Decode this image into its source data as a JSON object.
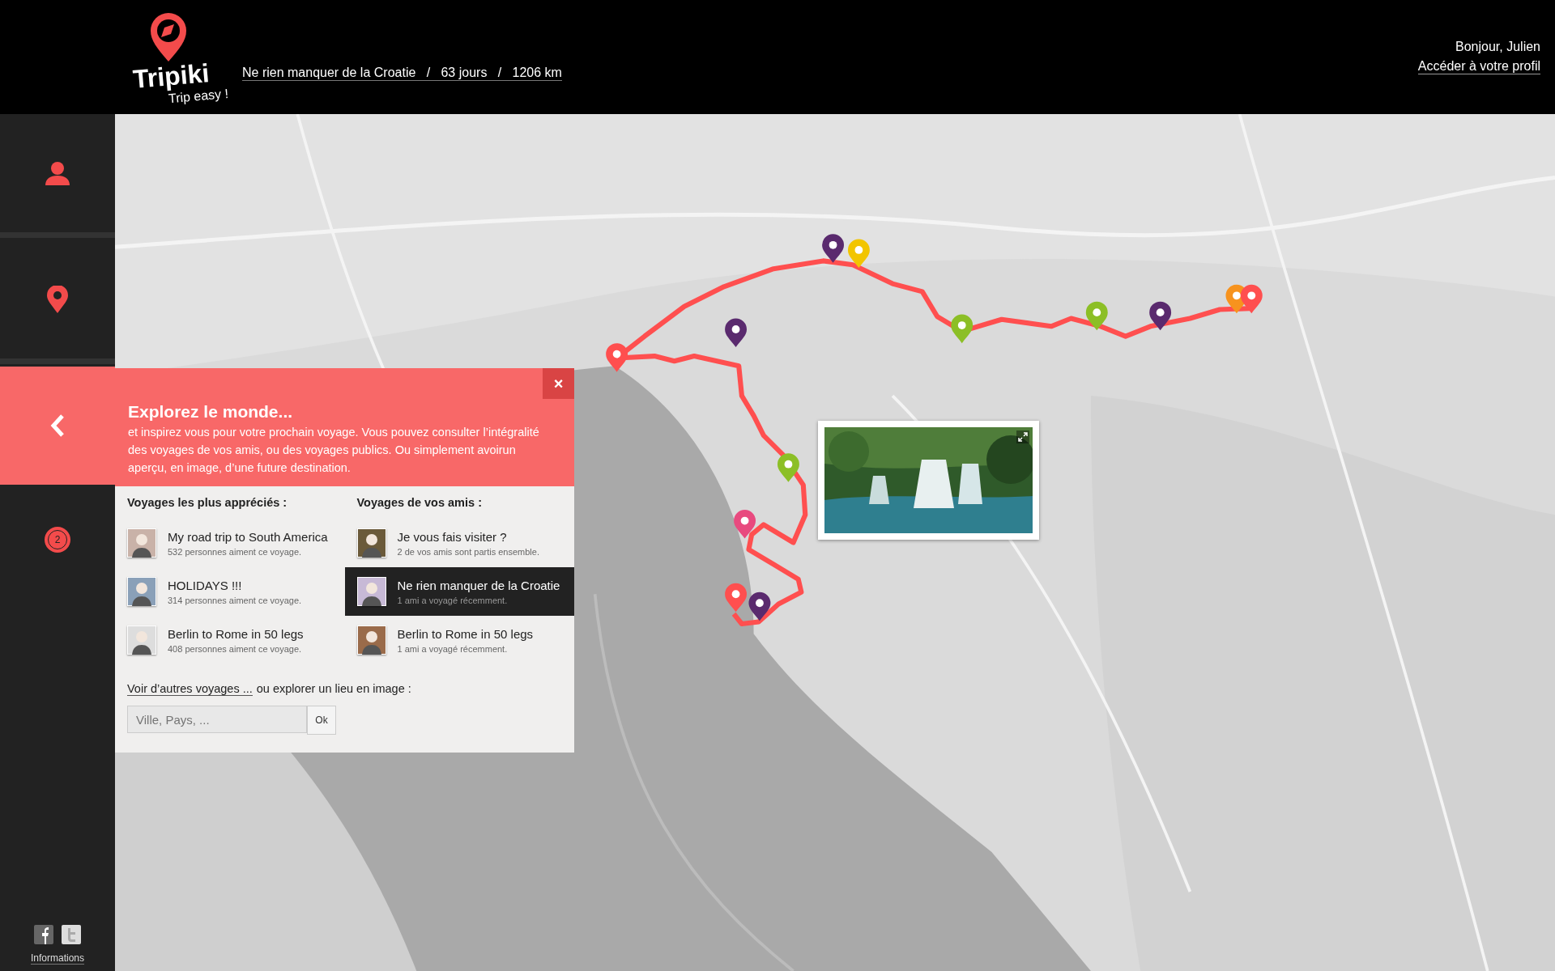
{
  "header": {
    "logo_name": "Tripiki",
    "logo_tagline": "Trip easy !",
    "trip_link": "Ne rien manquer de la Croatie   /   63 jours   /   1206 km",
    "greeting": "Bonjour, Julien",
    "profile_link": "Accéder à votre profil"
  },
  "sidebar": {
    "items": [
      {
        "kind": "profile",
        "selected": false
      },
      {
        "kind": "places",
        "selected": false
      },
      {
        "kind": "explore",
        "selected": true
      }
    ],
    "notification_count": "2",
    "footer_link": "Informations"
  },
  "panel": {
    "title": "Explorez le monde...",
    "intro": "et inspirez vous pour votre prochain voyage. Vous pouvez consulter l’intégralité des voyages de vos amis, ou des voyages publics. Ou simplement avoirun aperçu, en image, d’une future destination.",
    "close": "×",
    "columns": [
      {
        "heading": "Voyages les plus appréciés :",
        "trips": [
          {
            "title": "My road trip to South America",
            "subtitle": "532 personnes aiment ce voyage.",
            "selected": false
          },
          {
            "title": "HOLIDAYS !!!",
            "subtitle": "314 personnes aiment ce voyage.",
            "selected": false
          },
          {
            "title": "Berlin to Rome in 50 legs",
            "subtitle": "408 personnes aiment ce voyage.",
            "selected": false
          }
        ]
      },
      {
        "heading": "Voyages de vos amis :",
        "trips": [
          {
            "title": "Je vous fais visiter ?",
            "subtitle": "2 de vos amis sont partis ensemble.",
            "selected": false
          },
          {
            "title": "Ne rien manquer de la Croatie",
            "subtitle": "1 ami a voyagé récemment.",
            "selected": true
          },
          {
            "title": "Berlin to Rome in 50 legs",
            "subtitle": "1 ami a voyagé récemment.",
            "selected": false
          }
        ]
      }
    ],
    "more_link": "Voir d’autres voyages ...",
    "more_text": "ou explorer un lieu en image :",
    "search": {
      "placeholder": "Ville, Pays, ..."
    },
    "search_button": "Ok"
  }
}
